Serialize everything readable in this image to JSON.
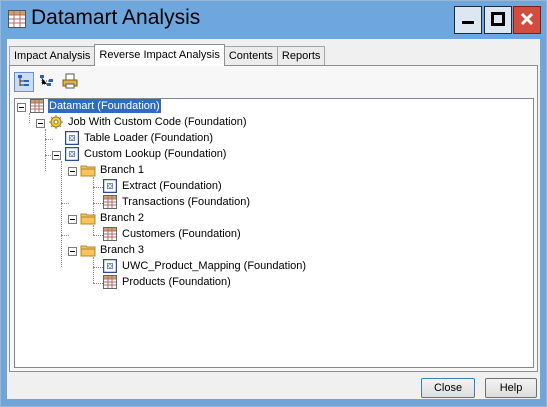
{
  "window": {
    "title": "Datamart Analysis",
    "title_icon": "table-icon"
  },
  "titlebar_buttons": {
    "minimize_icon": "minimize-icon",
    "maximize_icon": "maximize-icon",
    "close_icon": "close-icon"
  },
  "tabs": [
    {
      "label": "Impact Analysis",
      "active": false
    },
    {
      "label": "Reverse Impact Analysis",
      "active": true
    },
    {
      "label": "Contents",
      "active": false
    },
    {
      "label": "Reports",
      "active": false
    }
  ],
  "toolbar": {
    "tools": [
      "tree-view-icon",
      "diagram-view-icon",
      "print-icon"
    ]
  },
  "tree": {
    "nodes": [
      {
        "label": "Datamart (Foundation)",
        "icon": "table-icon",
        "selected": true
      },
      {
        "label": "Job With Custom Code (Foundation)",
        "icon": "job-icon"
      },
      {
        "label": "Table Loader (Foundation)",
        "icon": "transform-icon"
      },
      {
        "label": "Custom Lookup (Foundation)",
        "icon": "transform-icon"
      },
      {
        "label": "Branch 1",
        "icon": "folder-icon"
      },
      {
        "label": "Extract (Foundation)",
        "icon": "transform-icon"
      },
      {
        "label": "Transactions (Foundation)",
        "icon": "table-icon"
      },
      {
        "label": "Branch 2",
        "icon": "folder-icon"
      },
      {
        "label": "Customers (Foundation)",
        "icon": "table-icon"
      },
      {
        "label": "Branch 3",
        "icon": "folder-icon"
      },
      {
        "label": "UWC_Product_Mapping (Foundation)",
        "icon": "transform-icon"
      },
      {
        "label": "Products (Foundation)",
        "icon": "table-icon"
      }
    ]
  },
  "buttons": {
    "close_label": "Close",
    "help_label": "Help"
  }
}
